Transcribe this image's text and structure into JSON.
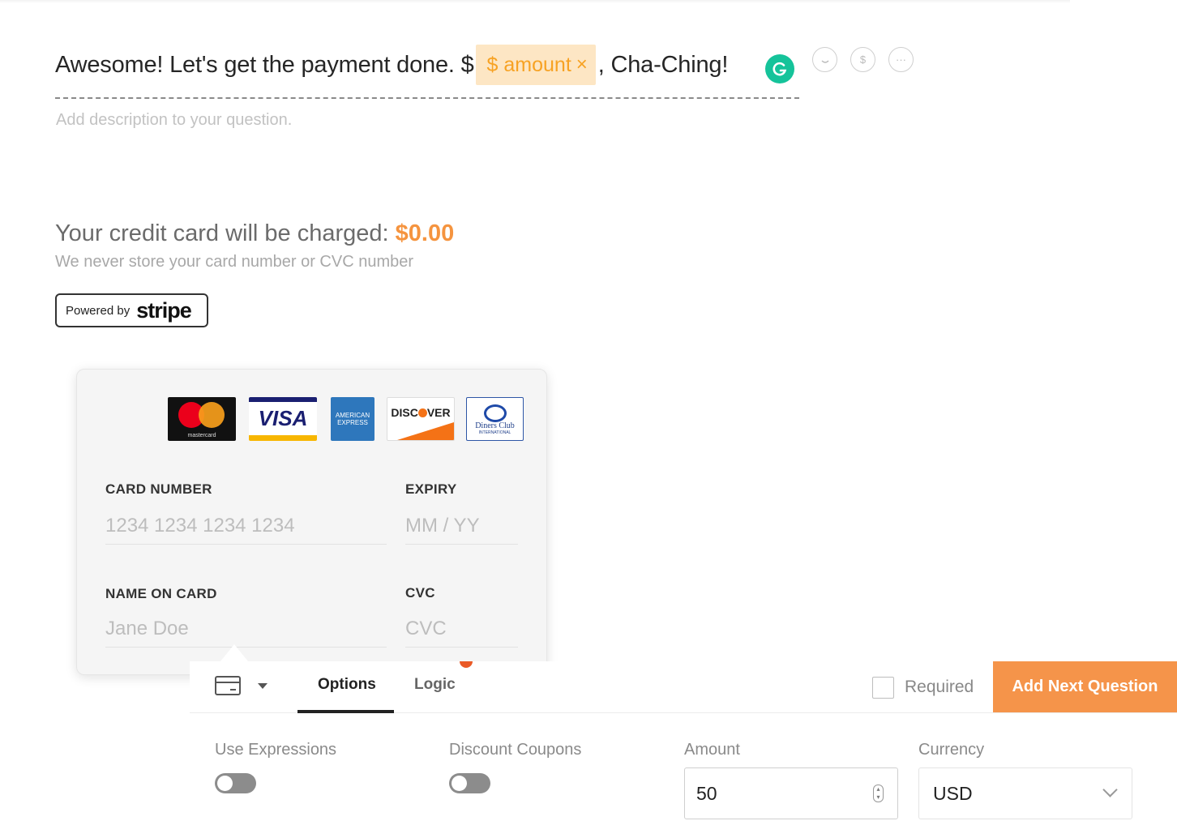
{
  "question": {
    "text_before": "Awesome! Let's get the payment done. $",
    "tag_symbol": "$",
    "tag_label": "amount",
    "tag_close": "×",
    "text_after": ", Cha-Ching!",
    "description_placeholder": "Add description to your question."
  },
  "question_icons": [
    "smiley-icon",
    "dollar-icon",
    "more-icon"
  ],
  "payment": {
    "charge_label": "Your credit card will be charged:",
    "charge_amount": "$0.00",
    "note": "We never store your card number or CVC number",
    "powered_by": "Powered by",
    "stripe": "stripe"
  },
  "card_logos": {
    "mastercard": "mastercard",
    "visa": "VISA",
    "amex_line1": "AMERICAN",
    "amex_line2": "EXPRESS",
    "discover_a": "DISC",
    "discover_b": "VER",
    "diners_line1": "Diners Club",
    "diners_line2": "INTERNATIONAL"
  },
  "card_form": {
    "card_number_label": "CARD NUMBER",
    "card_number_placeholder": "1234 1234 1234 1234",
    "expiry_label": "EXPIRY",
    "expiry_placeholder": "MM / YY",
    "name_label": "NAME ON CARD",
    "name_placeholder": "Jane Doe",
    "cvc_label": "CVC",
    "cvc_placeholder": "CVC"
  },
  "toolbar": {
    "tabs": [
      {
        "label": "Options",
        "active": true
      },
      {
        "label": "Logic",
        "active": false
      }
    ],
    "required_label": "Required",
    "required_checked": false,
    "add_next_label": "Add Next Question"
  },
  "options": {
    "use_expressions_label": "Use Expressions",
    "use_expressions_on": false,
    "discount_coupons_label": "Discount Coupons",
    "discount_coupons_on": false,
    "amount_label": "Amount",
    "amount_value": "50",
    "currency_label": "Currency",
    "currency_value": "USD"
  },
  "colors": {
    "accent": "#f5944a",
    "tag_bg": "#fde6c4",
    "tag_text": "#f7a223",
    "grammarly": "#15c39a"
  }
}
